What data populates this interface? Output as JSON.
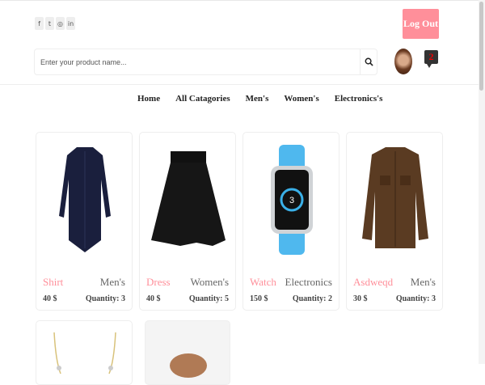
{
  "header": {
    "social": [
      "facebook-icon",
      "twitter-icon",
      "instagram-icon",
      "linkedin-icon"
    ],
    "logout_label": "Log Out",
    "search_placeholder": "Enter your product name...",
    "notification_count": "2"
  },
  "nav": {
    "items": [
      "Home",
      "All Catagories",
      "Men's",
      "Women's",
      "Electronics's"
    ]
  },
  "colors": {
    "accent": "#ff8f9a"
  },
  "products": [
    {
      "name": "Shirt",
      "category": "Men's",
      "price": "40 $",
      "quantity": "Quantity: 3"
    },
    {
      "name": "Dress",
      "category": "Women's",
      "price": "40 $",
      "quantity": "Quantity: 5"
    },
    {
      "name": "Watch",
      "category": "Electronics",
      "price": "150 $",
      "quantity": "Quantity: 2"
    },
    {
      "name": "Asdweqd",
      "category": "Men's",
      "price": "30 $",
      "quantity": "Quantity: 3"
    }
  ]
}
